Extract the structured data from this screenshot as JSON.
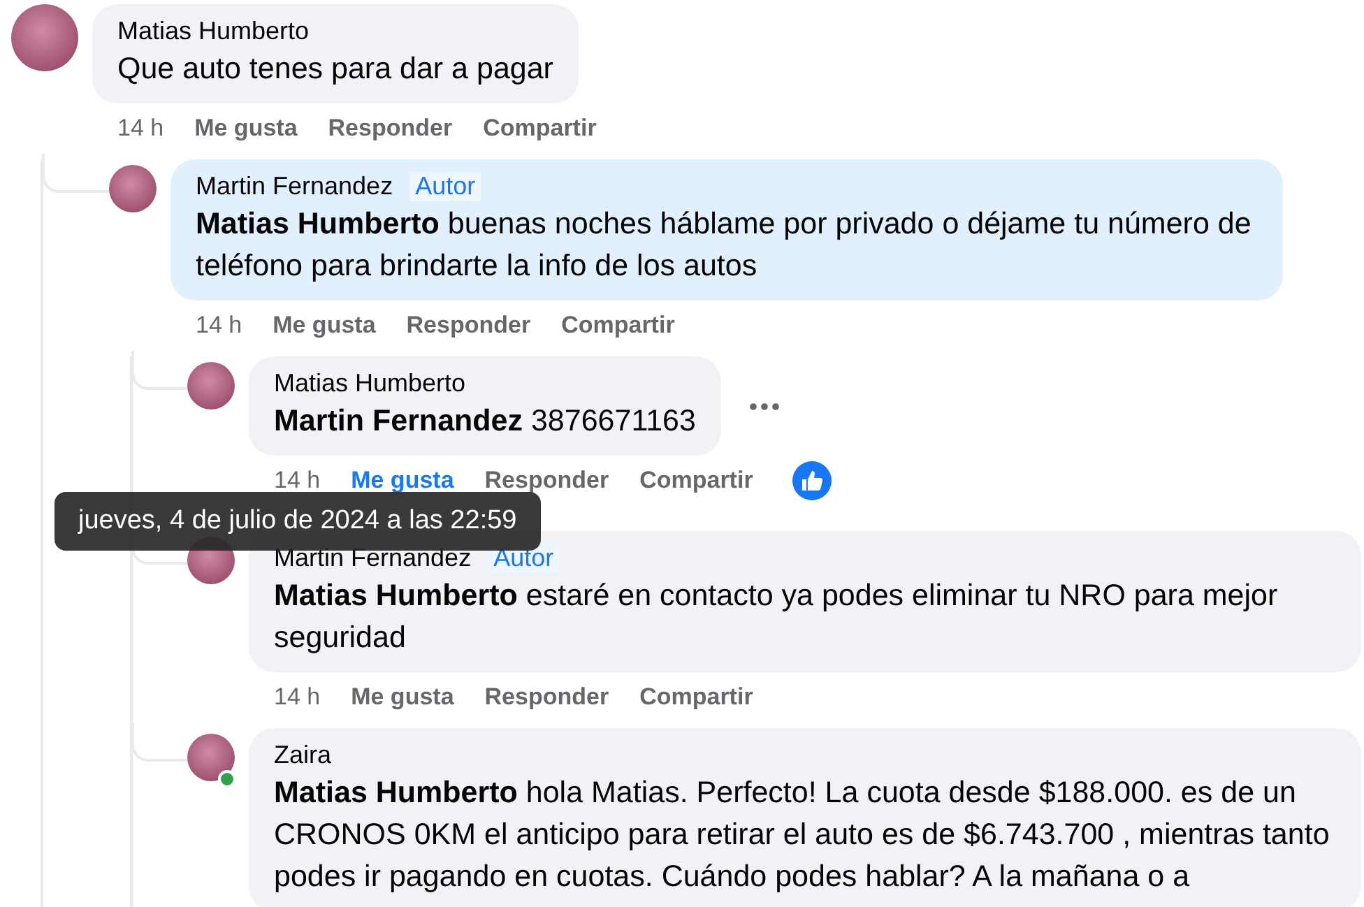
{
  "comments": [
    {
      "author": "Matias Humberto",
      "text": "Que auto tenes para dar a pagar",
      "time": "14 h",
      "like": "Me gusta",
      "liked": false,
      "reply": "Responder",
      "share": "Compartir",
      "children": [
        {
          "author": "Martin Fernandez",
          "author_badge": "Autor",
          "highlighted": true,
          "text": "**Matias Humberto** buenas noches háblame por privado o déjame tu número de teléfono para brindarte la info de los autos",
          "time": "14 h",
          "like": "Me gusta",
          "liked": false,
          "reply": "Responder",
          "share": "Compartir",
          "children": [
            {
              "author": "Matias Humberto",
              "text": "**Martin Fernandez** 3876671163",
              "time": "14 h",
              "like": "Me gusta",
              "liked": true,
              "reply": "Responder",
              "share": "Compartir",
              "more_options": true,
              "reacted": true
            },
            {
              "author": "Martin Fernandez",
              "author_badge": "Autor",
              "text": "**Matias Humberto** estaré en contacto ya podes eliminar tu NRO para mejor seguridad",
              "time": "14 h",
              "like": "Me gusta",
              "liked": false,
              "reply": "Responder",
              "share": "Compartir"
            },
            {
              "author": "Zaira",
              "online": true,
              "text": "**Matias Humberto** hola Matias. Perfecto! La cuota desde $188.000. es de un CRONOS 0KM el anticipo para retirar el auto es de $6.743.700 , mientras tanto podes ir pagando en cuotas. Cuándo podes hablar? A la mañana o a"
            }
          ]
        }
      ]
    }
  ],
  "tooltip": {
    "text": "jueves, 4 de julio de 2024 a las 22:59"
  }
}
